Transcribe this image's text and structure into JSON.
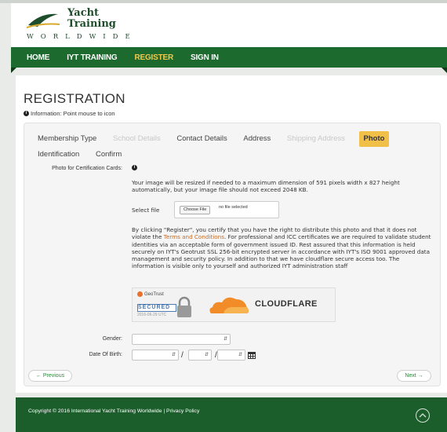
{
  "logo": {
    "line1": "Yacht",
    "line2": "Training",
    "line3": "WORLDWIDE"
  },
  "nav": {
    "items": [
      "HOME",
      "IYT TRAINING",
      "REGISTER",
      "SIGN IN"
    ]
  },
  "page": {
    "title": "REGISTRATION",
    "info": "Information: Point mouse to icon"
  },
  "tabs": [
    "Membership Type",
    "School Details",
    "Contact Details",
    "Address",
    "Shipping Address",
    "Photo",
    "Identification",
    "Confirm"
  ],
  "photo": {
    "label": "Photo for Certification Cards:",
    "resize_text": "Your image will be resized if needed to a maximum dimension of 591 pixels width x 827 height automatically, but your image file should not exceed 2048 KB.",
    "select_label": "Select file",
    "choose_btn": "Choose File",
    "file_status": "no file selected",
    "consent_a": "By clicking \"Register\", you certify that you have the right to distribute this photo and that it does not violate the ",
    "terms_link": "Terms and Conditions",
    "consent_b": ". For professional and ICC certificates we are required to validate student identities via an acceptable form of government issued ID. Rest assured that this information is held securely on IYT's Geotrust SSL 256-bit encrypted server in accordance with IYT's ISO 9001 approved data management and security policy. In addition to that we have cloudflare secure access too. The information is visible only to yourself and authorized IYT administration staff"
  },
  "badges": {
    "geotrust": "GeoTrust",
    "secured": "SECURED",
    "date": "2016-06-29 UTC",
    "cloudflare": "CLOUDFLARE"
  },
  "fields": {
    "gender_label": "Gender:",
    "dob_label": "Date Of Birth:",
    "slash": "/"
  },
  "pager": {
    "previous": "← Previous",
    "next": "Next →"
  },
  "footer": {
    "text": "Copyright © 2016 International Yacht Training Worldwide | Privacy Policy"
  },
  "colors": {
    "brand_green": "#1c6a2e",
    "accent_gold": "#f1c048",
    "link_orange": "#c26a24"
  }
}
